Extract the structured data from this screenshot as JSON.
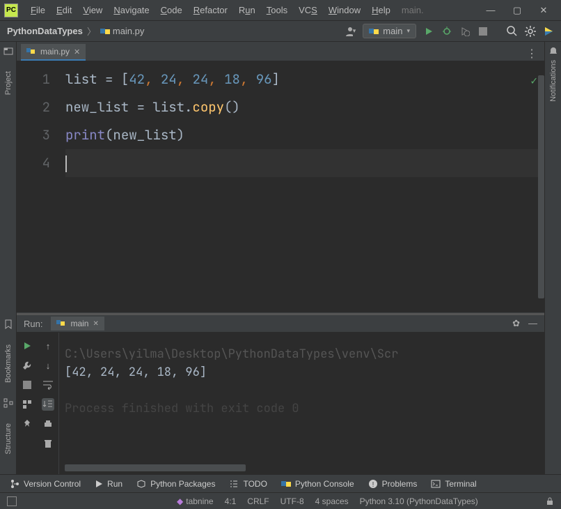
{
  "menu": [
    "File",
    "Edit",
    "View",
    "Navigate",
    "Code",
    "Refactor",
    "Run",
    "Tools",
    "VCS",
    "Window",
    "Help"
  ],
  "titlebar_context": "main.",
  "breadcrumbs": {
    "project": "PythonDataTypes",
    "file": "main.py"
  },
  "run_config": "main",
  "editor_tab": {
    "name": "main.py"
  },
  "code": {
    "lines": [
      "1",
      "2",
      "3",
      "4"
    ],
    "l1": {
      "a": "list",
      "eq": " = ",
      "open": "[",
      "v1": "42",
      "c": ", ",
      "v2": "24",
      "v3": "24",
      "v4": "18",
      "v5": "96",
      "close": "]"
    },
    "l2": {
      "a": "new_list",
      "eq": " = ",
      "b": "list",
      "dot": ".",
      "fn": "copy",
      "par": "()"
    },
    "l3": {
      "fn": "print",
      "open": "(",
      "arg": "new_list",
      "close": ")"
    }
  },
  "left_tools": {
    "project": "Project",
    "bookmarks": "Bookmarks",
    "structure": "Structure"
  },
  "right_tools": {
    "notifications": "Notifications"
  },
  "run_panel": {
    "title": "Run:",
    "tab": "main",
    "line1": "C:\\Users\\yilma\\Desktop\\PythonDataTypes\\venv\\Scr",
    "line2": "[42, 24, 24, 18, 96]",
    "line3": "Process finished with exit code 0"
  },
  "bottom": {
    "version_control": "Version Control",
    "run": "Run",
    "packages": "Python Packages",
    "todo": "TODO",
    "console": "Python Console",
    "problems": "Problems",
    "terminal": "Terminal"
  },
  "status": {
    "tabnine": "tabnine",
    "pos": "4:1",
    "eol": "CRLF",
    "enc": "UTF-8",
    "indent": "4 spaces",
    "interpreter": "Python 3.10 (PythonDataTypes)"
  }
}
